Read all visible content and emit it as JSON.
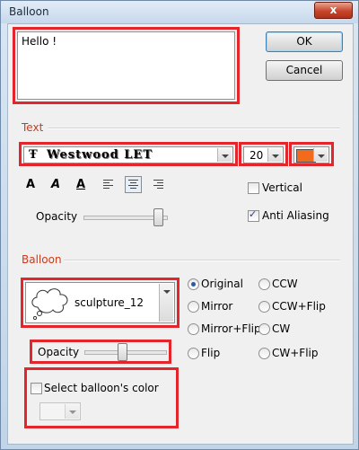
{
  "window": {
    "title": "Balloon",
    "close_glyph": "x"
  },
  "buttons": {
    "ok": "OK",
    "cancel": "Cancel"
  },
  "text_area": {
    "value": "Hello !"
  },
  "text_section": {
    "label": "Text",
    "font": {
      "icon_glyph": "Ŧ",
      "name": "Westwood LET"
    },
    "size": "20",
    "color": "#f26a1b",
    "style_buttons": {
      "bold": "A",
      "italic": "A",
      "underline": "A"
    },
    "vertical_label": "Vertical",
    "vertical_checked": false,
    "opacity_label": "Opacity",
    "opacity_value": 0.94,
    "anti_aliasing_label": "Anti Aliasing",
    "anti_aliasing_checked": true
  },
  "balloon_section": {
    "label": "Balloon",
    "shape": "sculpture_12",
    "orientation": {
      "options": [
        "Original",
        "Mirror",
        "Mirror+Flip",
        "Flip",
        "CCW",
        "CCW+Flip",
        "CW",
        "CW+Flip"
      ],
      "selected": "Original"
    },
    "opacity_label": "Opacity",
    "opacity_value": 0.46,
    "select_color_label": "Select balloon's color",
    "select_color_checked": false
  },
  "icons": [
    "close-icon",
    "text-font-icon",
    "balloon-cloud-icon",
    "dropdown-arrow-icon",
    "align-left-icon",
    "align-center-icon",
    "align-right-icon"
  ]
}
